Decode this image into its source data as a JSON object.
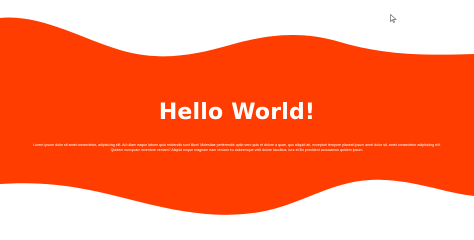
{
  "colors": {
    "wave_fill": "#ff3d00",
    "background": "#ffffff",
    "text": "#ffffff"
  },
  "hero": {
    "title": "Hello World!",
    "paragraph": "Lorem ipsum dolor sit amet consectetur, adipisicing elit. Ad ullam eaque labore quia reiciendis sunt illum! Molestiae perferendis optio vero quis et dolore a quae, quo aliquid ab, excepturi tempore placeat ipsum amet dolor sit, amet consectetur adipisicing elit. Quidem numquam inventore veniam? Aliquid neque magnam nam veniam eu doloremque velit dolore faucibus. Iure et illo provident accusamus quidem ipsum."
  },
  "cursor_icon": "mouse-pointer-icon"
}
